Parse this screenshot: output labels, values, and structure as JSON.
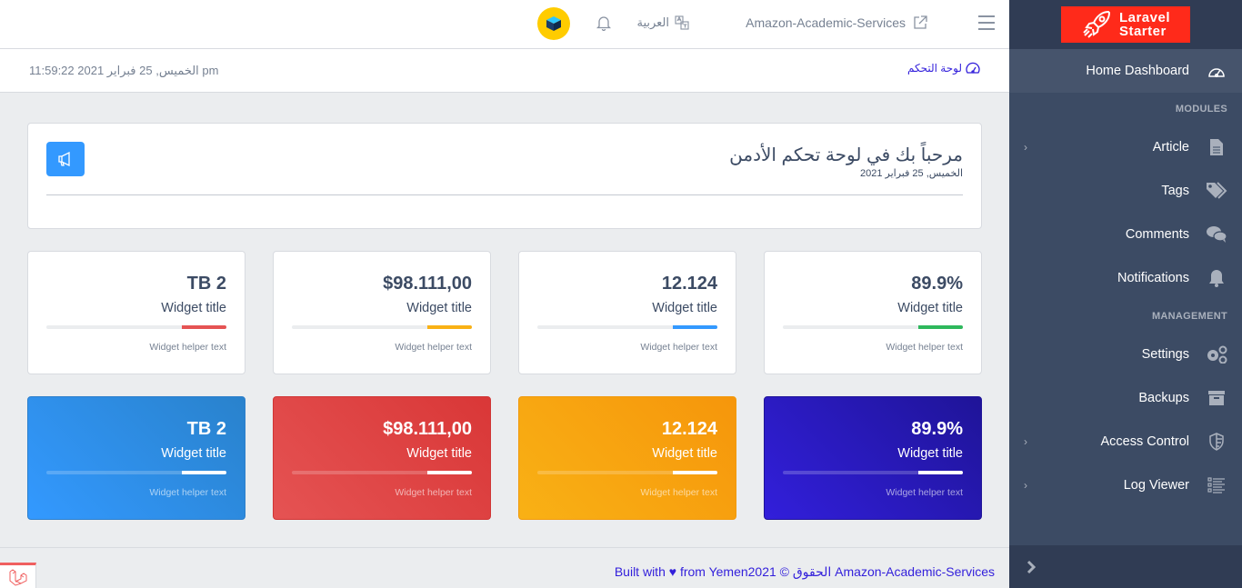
{
  "sidebar": {
    "brand": {
      "line1": "Laravel",
      "line2": "Starter",
      "color": "#ff2a1a"
    },
    "home": {
      "label": "Home Dashboard",
      "icon": "speedometer-icon"
    },
    "sections": [
      {
        "title": "MODULES",
        "items": [
          {
            "label": "Article",
            "icon": "file-icon",
            "has_children": true
          },
          {
            "label": "Tags",
            "icon": "tags-icon",
            "has_children": false
          },
          {
            "label": "Comments",
            "icon": "comments-icon",
            "has_children": false
          },
          {
            "label": "Notifications",
            "icon": "bell-icon",
            "has_children": false
          }
        ]
      },
      {
        "title": "MANAGEMENT",
        "items": [
          {
            "label": "Settings",
            "icon": "cogs-icon",
            "has_children": false
          },
          {
            "label": "Backups",
            "icon": "archive-icon",
            "has_children": false
          },
          {
            "label": "Access Control",
            "icon": "shield-icon",
            "has_children": true
          },
          {
            "label": "Log Viewer",
            "icon": "list-icon",
            "has_children": true
          }
        ]
      }
    ],
    "minimizer_icon": "chevron-right-icon"
  },
  "header": {
    "app_link": "Amazon-Academic-Services",
    "language": "العربية",
    "notifications_icon": "bell-icon"
  },
  "subheader": {
    "breadcrumb": "لوحة التحكم",
    "datetime": "الخميس, 25 فبراير 2021 11:59:22 pm"
  },
  "welcome": {
    "title": "مرحباً بك في لوحة تحكم الأدمن",
    "date": "الخميس, 25 فبراير 2021"
  },
  "widgets_light": [
    {
      "value": "89.9%",
      "title": "Widget title",
      "helper": "Widget helper text",
      "progress": 25,
      "color": "#2eb85c"
    },
    {
      "value": "12.124",
      "title": "Widget title",
      "helper": "Widget helper text",
      "progress": 25,
      "color": "#39f"
    },
    {
      "value": "$98.111,00",
      "title": "Widget title",
      "helper": "Widget helper text",
      "progress": 25,
      "color": "#f9b115"
    },
    {
      "value": "TB 2",
      "title": "Widget title",
      "helper": "Widget helper text",
      "progress": 25,
      "color": "#e55353"
    }
  ],
  "widgets_dark": [
    {
      "value": "89.9%",
      "title": "Widget title",
      "helper": "Widget helper text",
      "progress": 25,
      "theme": "primary"
    },
    {
      "value": "12.124",
      "title": "Widget title",
      "helper": "Widget helper text",
      "progress": 25,
      "theme": "warning"
    },
    {
      "value": "$98.111,00",
      "title": "Widget title",
      "helper": "Widget helper text",
      "progress": 25,
      "theme": "danger"
    },
    {
      "value": "TB 2",
      "title": "Widget title",
      "helper": "Widget helper text",
      "progress": 25,
      "theme": "info"
    }
  ],
  "footer": {
    "text": "Built with ♥ from Yemen2021 © الحقوق Amazon-Academic-Services"
  }
}
